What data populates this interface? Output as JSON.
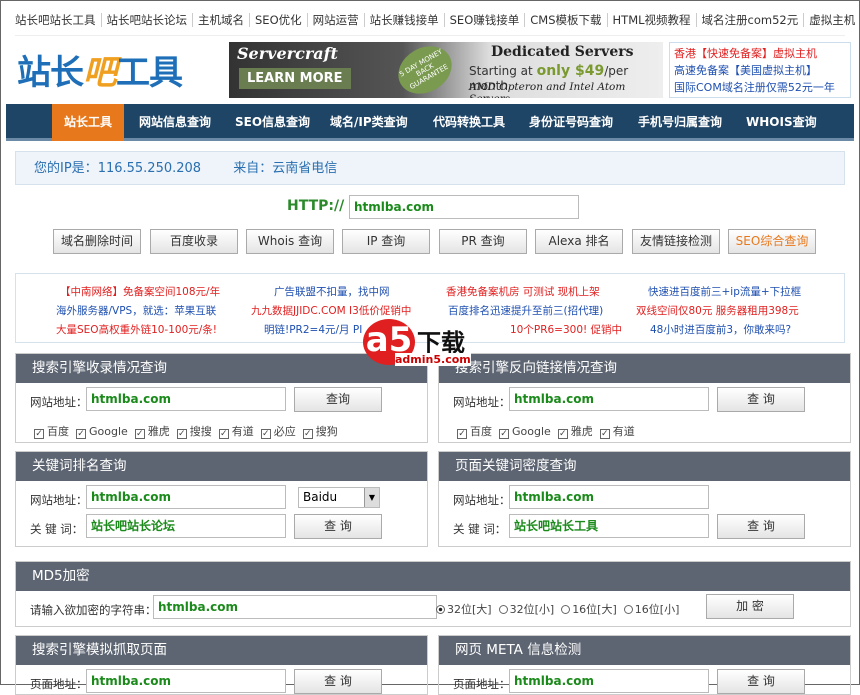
{
  "top_links": [
    "站长吧站长工具",
    "站长吧站长论坛",
    "主机域名",
    "SEO优化",
    "网站运营",
    "站长赚钱接单",
    "SEO赚钱接单",
    "CMS模板下载",
    "HTML视频教程",
    "域名注册com52元",
    "虚拟主机"
  ],
  "logo": {
    "part1": "站长",
    "part2": "吧",
    "part3": "工具"
  },
  "banner": {
    "brand": "Servercraft",
    "cta": "LEARN MORE",
    "title": "Dedicated Servers",
    "starting": "Starting at",
    "price": "only $49",
    "per": "/per month",
    "cpu": "AMD Opteron and Intel Atom Servers.",
    "badge": "5 DAY MONEY BACK GUARANTEE"
  },
  "side_ads": [
    "香港【快速免备案】虚拟主机",
    "高速免备案【美国虚拟主机】",
    "国际COM域名注册仅需52元一年"
  ],
  "nav": [
    "站长工具",
    "网站信息查询",
    "SEO信息查询",
    "域名/IP类查询",
    "代码转换工具",
    "身份证号码查询",
    "手机号归属查询",
    "WHOIS查询"
  ],
  "ip": {
    "label": "您的IP是：",
    "value": "116.55.250.208",
    "from_label": "来自：",
    "from": "云南省电信"
  },
  "http": {
    "label": "HTTP://",
    "value": "htmlba.com"
  },
  "tools": [
    "域名删除时间",
    "百度收录",
    "Whois 查询",
    "IP 查询",
    "PR 查询",
    "Alexa 排名",
    "友情链接检测",
    "SEO综合查询"
  ],
  "ads": [
    [
      "【中南网络】免备案空间108元/年",
      "海外服务器/VPS，就选：苹果互联",
      "大量SEO高权重外链10-100元/条!"
    ],
    [
      "广告联盟不扣量，找中网",
      "九九数据JJIDC.COM I3低价促销中",
      "明链!PR2=4元/月 PI"
    ],
    [
      "香港免备案机房 可测试 现机上架",
      "百度排名迅速提升至前三(招代理)",
      "10个PR6=300! 促销中"
    ],
    [
      "快速进百度前三+ip流量+下拉框",
      "双线空间仅80元 服务器租用398元",
      "48小时进百度前3，你敢来吗?"
    ]
  ],
  "watermark": {
    "logo": "a5",
    "text": "下载",
    "site": "admin5.com"
  },
  "p1": {
    "title": "搜索引擎收录情况查询",
    "label": "网站地址：",
    "value": "htmlba.com",
    "button": "查询",
    "checks": [
      "百度",
      "Google",
      "雅虎",
      "搜搜",
      "有道",
      "必应",
      "搜狗"
    ]
  },
  "p2": {
    "title": "搜索引擎反向链接情况查询",
    "label": "网站地址：",
    "value": "htmlba.com",
    "button": "查 询",
    "checks": [
      "百度",
      "Google",
      "雅虎",
      "有道"
    ]
  },
  "p3": {
    "title": "关键词排名查询",
    "label": "网站地址：",
    "value": "htmlba.com",
    "engine": "Baidu",
    "kw_label": "关 键 词：",
    "kw": "站长吧站长论坛",
    "button": "查 询"
  },
  "p4": {
    "title": "页面关键词密度查询",
    "label": "网站地址：",
    "value": "htmlba.com",
    "kw_label": "关 键 词：",
    "kw": "站长吧站长工具",
    "button": "查 询"
  },
  "md5": {
    "title": "MD5加密",
    "label": "请输入欲加密的字符串：",
    "value": "htmlba.com",
    "options": [
      "32位[大]",
      "32位[小]",
      "16位[大]",
      "16位[小]"
    ],
    "button": "加 密"
  },
  "p5": {
    "title": "搜索引擎模拟抓取页面",
    "label": "页面地址：",
    "value": "htmlba.com",
    "button": "查 询"
  },
  "p6": {
    "title": "网页 META 信息检测",
    "label": "页面地址：",
    "value": "htmlba.com",
    "button": "查 询"
  },
  "colors": {
    "nav": "#1e4466",
    "active": "#e8781c",
    "panel_header": "#5d6572",
    "red_ad": "#e02020",
    "blue_ad": "#1e4fb0"
  }
}
